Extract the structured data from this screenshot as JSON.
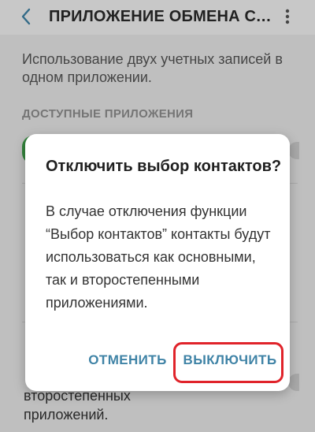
{
  "header": {
    "title": "ПРИЛОЖЕНИЕ ОБМЕНА СООБЩЕНИЯМИ"
  },
  "page": {
    "description": "Использование двух учетных записей в одном приложении.",
    "section_label": "ДОСТУПНЫЕ ПРИЛОЖЕНИЯ",
    "bottom_text_line1": "второстепенных",
    "bottom_text_line2": "приложений."
  },
  "dialog": {
    "title": "Отключить выбор контактов?",
    "body": "В случае отключения функции “Выбор контактов” контакты будут использоваться как основными, так и второстепенными приложениями.",
    "cancel_label": "ОТМЕНИТЬ",
    "disable_label": "ВЫКЛЮЧИТЬ"
  },
  "colors": {
    "accent": "#3f83a6",
    "highlight": "#e0232a",
    "app_icon": "#3fa24a"
  }
}
